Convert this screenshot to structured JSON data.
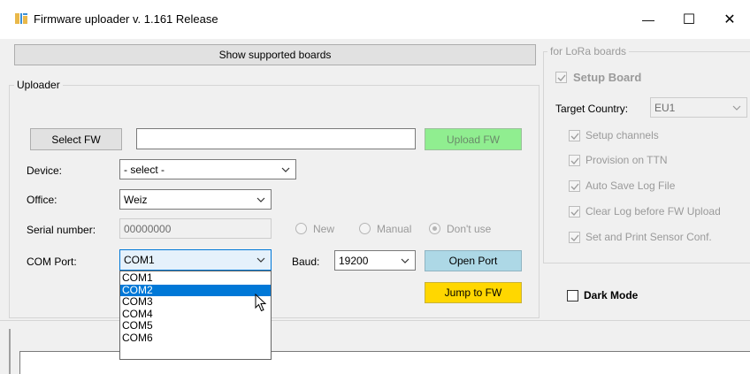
{
  "window": {
    "title": "Firmware uploader v. 1.161 Release",
    "minimize_glyph": "—",
    "maximize_glyph": "☐",
    "close_glyph": "✕"
  },
  "toolbar": {
    "show_boards_label": "Show supported boards"
  },
  "uploader": {
    "group_title": "Uploader",
    "select_fw_label": "Select FW",
    "fw_path_value": "",
    "upload_fw_label": "Upload FW",
    "device_label": "Device:",
    "device_value": "- select -",
    "office_label": "Office:",
    "office_value": "Weiz",
    "serial_label": "Serial number:",
    "serial_value": "00000000",
    "radio_new": "New",
    "radio_manual": "Manual",
    "radio_dont_use": "Don't use",
    "com_port_label": "COM Port:",
    "com_port_value": "COM1",
    "com_port_options": [
      "COM1",
      "COM2",
      "COM3",
      "COM4",
      "COM5",
      "COM6"
    ],
    "com_port_highlighted": "COM2",
    "baud_label": "Baud:",
    "baud_value": "19200",
    "open_port_label": "Open Port",
    "jump_fw_label": "Jump to FW"
  },
  "lora": {
    "group_title": "for LoRa boards",
    "setup_board_label": "Setup Board",
    "target_country_label": "Target Country:",
    "target_country_value": "EU1",
    "options": [
      "Setup channels",
      "Provision on TTN",
      "Auto Save Log File",
      "Clear Log before FW Upload",
      "Set and Print Sensor Conf."
    ]
  },
  "dark_mode_label": "Dark Mode",
  "colors": {
    "upload_btn": "#90ee90",
    "open_port_btn": "#add8e6",
    "jump_btn": "#ffd700",
    "selection": "#0078d7"
  },
  "icons": {
    "app": "firmware-app-icon",
    "cursor": "mouse-pointer-icon"
  }
}
